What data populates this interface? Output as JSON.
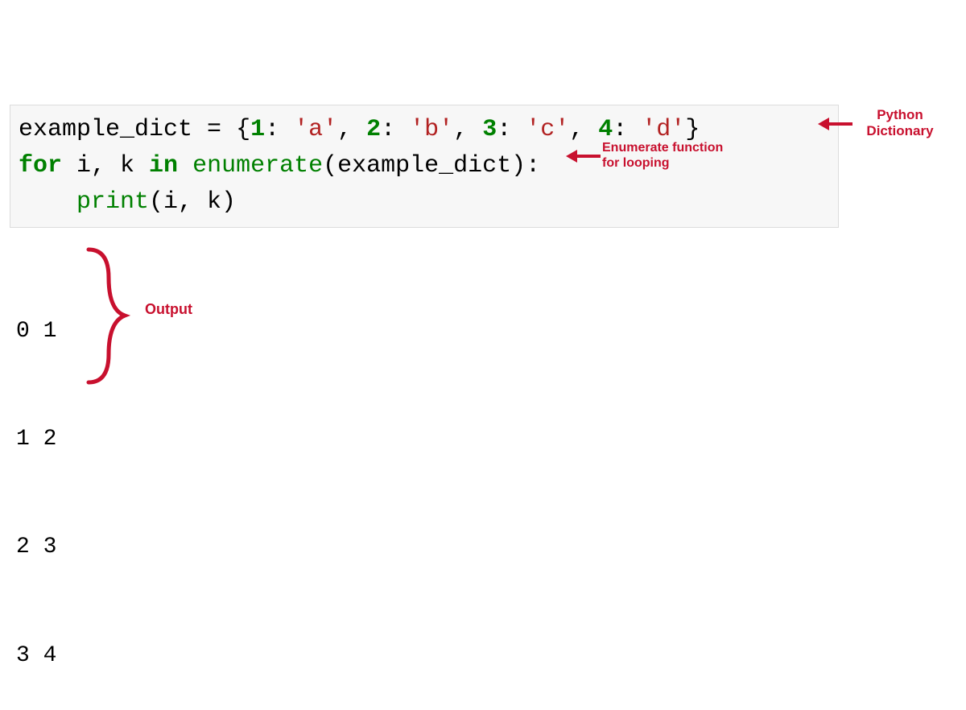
{
  "code": {
    "line1": {
      "var": "example_dict ",
      "eq": "= ",
      "brace_open": "{",
      "k1": "1",
      "colon1": ": ",
      "v1": "'a'",
      "comma1": ", ",
      "k2": "2",
      "colon2": ": ",
      "v2": "'b'",
      "comma2": ", ",
      "k3": "3",
      "colon3": ": ",
      "v3": "'c'",
      "comma3": ", ",
      "k4": "4",
      "colon4": ": ",
      "v4": "'d'",
      "brace_close": "}"
    },
    "line2": {
      "for": "for",
      "sp1": " i, k ",
      "in": "in",
      "sp2": " ",
      "enum": "enumerate",
      "paren_open": "(",
      "arg": "example_dict",
      "paren_close": "):"
    },
    "line3": {
      "indent": "    ",
      "print": "print",
      "args": "(i, k)"
    }
  },
  "output": {
    "l1": "0 1",
    "l2": "1 2",
    "l3": "2 3",
    "l4": "3 4"
  },
  "annotations": {
    "dict_line1": "Python",
    "dict_line2": "Dictionary",
    "enum_line1": "Enumerate function",
    "enum_line2": "for looping",
    "output": "Output"
  }
}
